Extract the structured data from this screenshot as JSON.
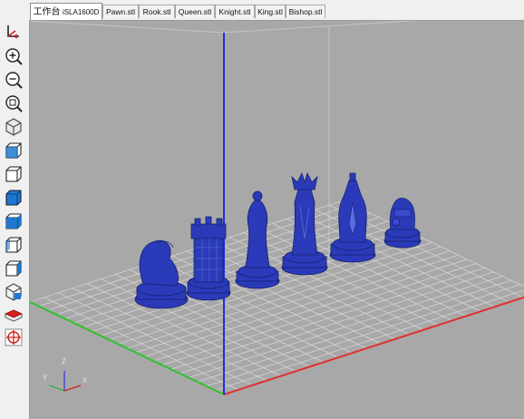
{
  "tabs": [
    {
      "label_main": "工作台",
      "label_sub": "iSLA1600D",
      "active": true
    },
    {
      "label": "Pawn.stl"
    },
    {
      "label": "Rook.stl"
    },
    {
      "label": "Queen.stl"
    },
    {
      "label": "Knight.stl"
    },
    {
      "label": "King.stl"
    },
    {
      "label": "Bishop.stl"
    }
  ],
  "toolbar": [
    {
      "icon": "axis-pointer-icon"
    },
    {
      "icon": "zoom-in-icon"
    },
    {
      "icon": "zoom-out-icon"
    },
    {
      "icon": "zoom-fit-icon"
    },
    {
      "icon": "iso-view-icon"
    },
    {
      "icon": "front-view-icon"
    },
    {
      "icon": "back-view-icon"
    },
    {
      "icon": "top-view-icon"
    },
    {
      "icon": "left-view-icon"
    },
    {
      "icon": "right-view-icon"
    },
    {
      "icon": "bottom-view-icon"
    },
    {
      "icon": "perspective-view-icon"
    },
    {
      "icon": "slice-plane-icon"
    },
    {
      "icon": "crosshair-icon"
    }
  ],
  "axes": {
    "x": "X",
    "y": "Y",
    "z": "Z"
  },
  "colors": {
    "viewport_bg": "#a8a8a8",
    "grid": "#d0d0d0",
    "model": "#2a3ab8",
    "x_axis": "#e03030",
    "y_axis": "#30c030",
    "z_axis": "#2030e0"
  }
}
